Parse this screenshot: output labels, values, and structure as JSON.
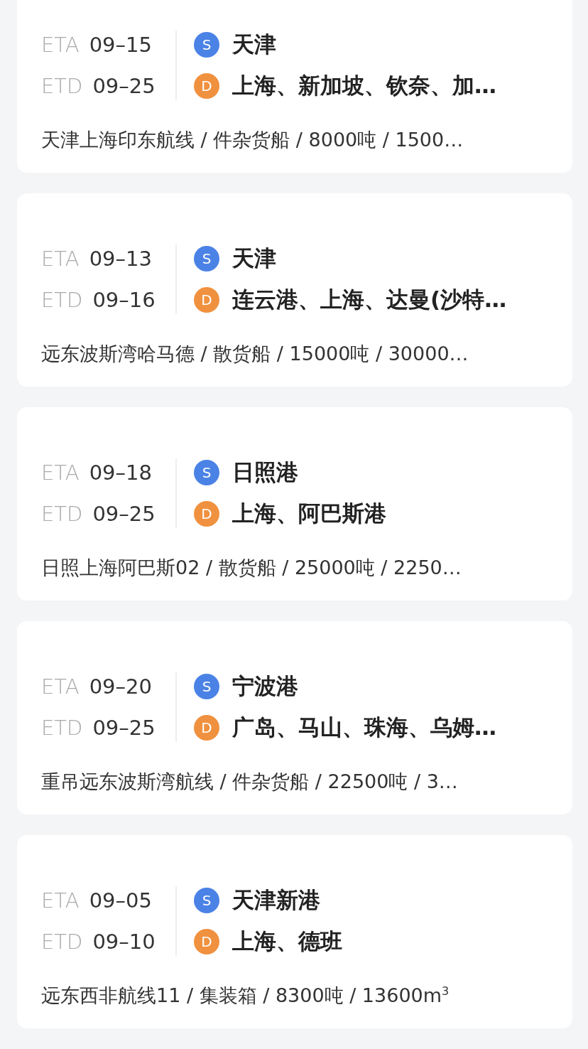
{
  "voyages": [
    {
      "arrival": {
        "label": "ETA",
        "date": "09–15"
      },
      "departure": {
        "label": "ETD",
        "date": "09–25"
      },
      "ports": [
        {
          "kind": "origin",
          "badge": "S",
          "text": "天津"
        },
        {
          "kind": "destination",
          "badge": "D",
          "text": "上海、新加坡、钦奈、加…"
        }
      ],
      "summary": "天津上海印东航线 / 件杂货船 / 8000吨 / 1500…"
    },
    {
      "arrival": {
        "label": "ETA",
        "date": "09–13"
      },
      "departure": {
        "label": "ETD",
        "date": "09–16"
      },
      "ports": [
        {
          "kind": "origin",
          "badge": "S",
          "text": "天津"
        },
        {
          "kind": "destination",
          "badge": "D",
          "text": "连云港、上海、达曼(沙特…"
        }
      ],
      "summary": "远东波斯湾哈马德 / 散货船 / 15000吨 / 30000…"
    },
    {
      "arrival": {
        "label": "ETA",
        "date": "09–18"
      },
      "departure": {
        "label": "ETD",
        "date": "09–25"
      },
      "ports": [
        {
          "kind": "origin",
          "badge": "S",
          "text": "日照港"
        },
        {
          "kind": "destination",
          "badge": "D",
          "text": "上海、阿巴斯港"
        }
      ],
      "summary": "日照上海阿巴斯02 / 散货船 / 25000吨 / 2250…"
    },
    {
      "arrival": {
        "label": "ETA",
        "date": "09–20"
      },
      "departure": {
        "label": "ETD",
        "date": "09–25"
      },
      "ports": [
        {
          "kind": "origin",
          "badge": "S",
          "text": "宁波港"
        },
        {
          "kind": "destination",
          "badge": "D",
          "text": "广岛、马山、珠海、乌姆…"
        }
      ],
      "summary": "重吊远东波斯湾航线 / 件杂货船 / 22500吨 / 3…"
    },
    {
      "arrival": {
        "label": "ETA",
        "date": "09–05"
      },
      "departure": {
        "label": "ETD",
        "date": "09–10"
      },
      "ports": [
        {
          "kind": "origin",
          "badge": "S",
          "text": "天津新港"
        },
        {
          "kind": "destination",
          "badge": "D",
          "text": "上海、德班"
        }
      ],
      "summary": "远东西非航线11 / 集装箱 / 8300吨 / 13600m$^{3}$"
    }
  ]
}
